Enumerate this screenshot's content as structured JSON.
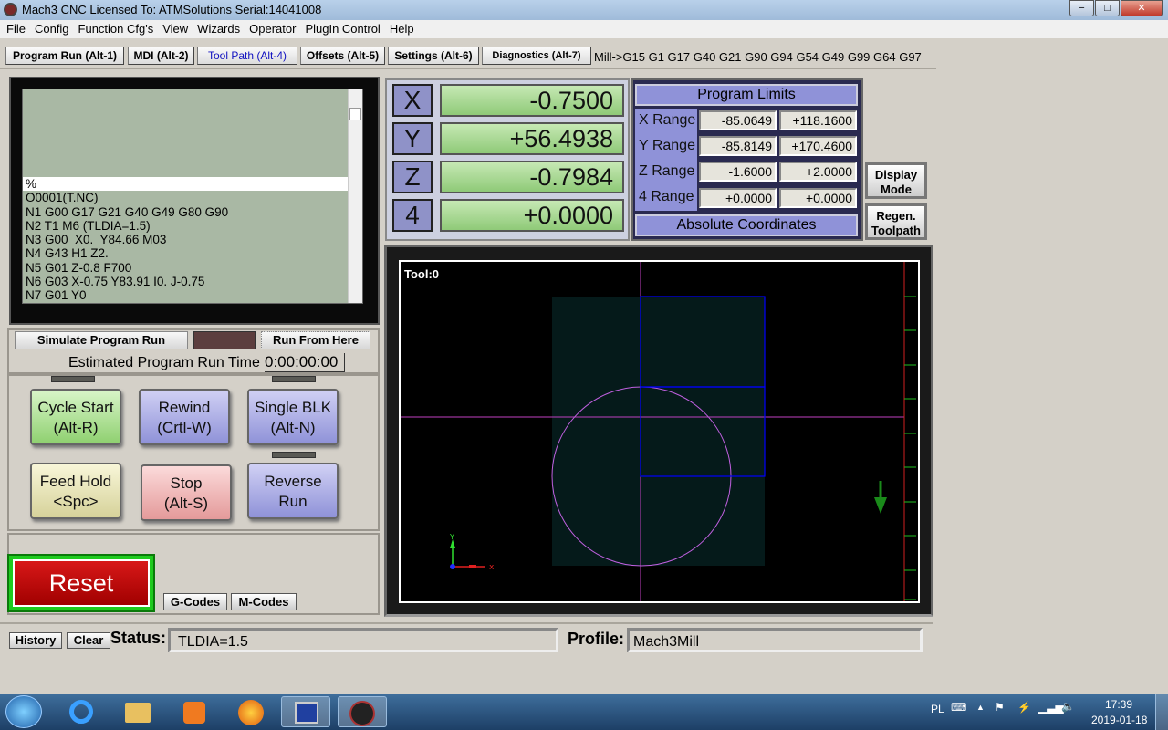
{
  "window": {
    "title": "Mach3 CNC  Licensed To: ATMSolutions Serial:14041008",
    "minimize": "−",
    "maximize": "□",
    "close": "✕"
  },
  "menu": [
    "File",
    "Config",
    "Function Cfg's",
    "View",
    "Wizards",
    "Operator",
    "PlugIn Control",
    "Help"
  ],
  "tabs": [
    {
      "label": "Program Run (Alt-1)"
    },
    {
      "label": "MDI (Alt-2)"
    },
    {
      "label": "Tool Path (Alt-4)",
      "active": true
    },
    {
      "label": "Offsets (Alt-5)"
    },
    {
      "label": "Settings (Alt-6)"
    },
    {
      "label": "Diagnostics (Alt-7)"
    }
  ],
  "modal_line": "Mill->G15  G1 G17 G40 G21 G90 G94 G54 G49 G99 G64 G97",
  "gcode": {
    "lines": [
      "%",
      "O0001(T.NC)",
      "N1 G00 G17 G21 G40 G49 G80 G90",
      "N2 T1 M6 (TLDIA=1.5)",
      "N3 G00  X0.  Y84.66 M03",
      "N4 G43 H1 Z2.",
      "N5 G01 Z-0.8 F700",
      "N6 G03 X-0.75 Y83.91 I0. J-0.75",
      "N7 G01 Y0"
    ],
    "current_line": 0
  },
  "simulate": {
    "simulate_label": "Simulate Program Run",
    "run_from_here_label": "Run From Here",
    "estimated_label": "Estimated Program Run Time",
    "estimated_value": "0:00:00:00"
  },
  "controls": {
    "cycle_start": [
      "Cycle Start",
      "(Alt-R)"
    ],
    "rewind": [
      "Rewind",
      "(Crtl-W)"
    ],
    "single_blk": [
      "Single BLK",
      "(Alt-N)"
    ],
    "feed_hold": [
      "Feed Hold",
      "<Spc>"
    ],
    "stop": [
      "Stop",
      "(Alt-S)"
    ],
    "reverse_run": [
      "Reverse",
      "Run"
    ],
    "reset": "Reset",
    "gcodes": "G-Codes",
    "mcodes": "M-Codes"
  },
  "dro": [
    {
      "axis": "X",
      "value": "-0.7500"
    },
    {
      "axis": "Y",
      "value": "+56.4938"
    },
    {
      "axis": "Z",
      "value": "-0.7984"
    },
    {
      "axis": "4",
      "value": "+0.0000"
    }
  ],
  "limits": {
    "title": "Program Limits",
    "rows": [
      {
        "label": "X Range",
        "min": "-85.0649",
        "max": "+118.1600"
      },
      {
        "label": "Y Range",
        "min": "-85.8149",
        "max": "+170.4600"
      },
      {
        "label": "Z Range",
        "min": "-1.6000",
        "max": "+2.0000"
      },
      {
        "label": "4 Range",
        "min": "+0.0000",
        "max": "+0.0000"
      }
    ],
    "footer": "Absolute Coordinates"
  },
  "side_buttons": {
    "display_mode": [
      "Display",
      "Mode"
    ],
    "regen": [
      "Regen.",
      "Toolpath"
    ]
  },
  "toolpath": {
    "tool_label": "Tool:0",
    "colors": {
      "path": "#0000ff",
      "circle": "#c060e0",
      "stock": "#051a1a",
      "crosshair": "#c040c0"
    }
  },
  "status": {
    "history": "History",
    "clear": "Clear",
    "status_label": "Status:",
    "status_value": "TLDIA=1.5",
    "profile_label": "Profile:",
    "profile_value": "Mach3Mill"
  },
  "taskbar": {
    "lang": "PL",
    "time": "17:39",
    "date": "2019-01-18"
  }
}
